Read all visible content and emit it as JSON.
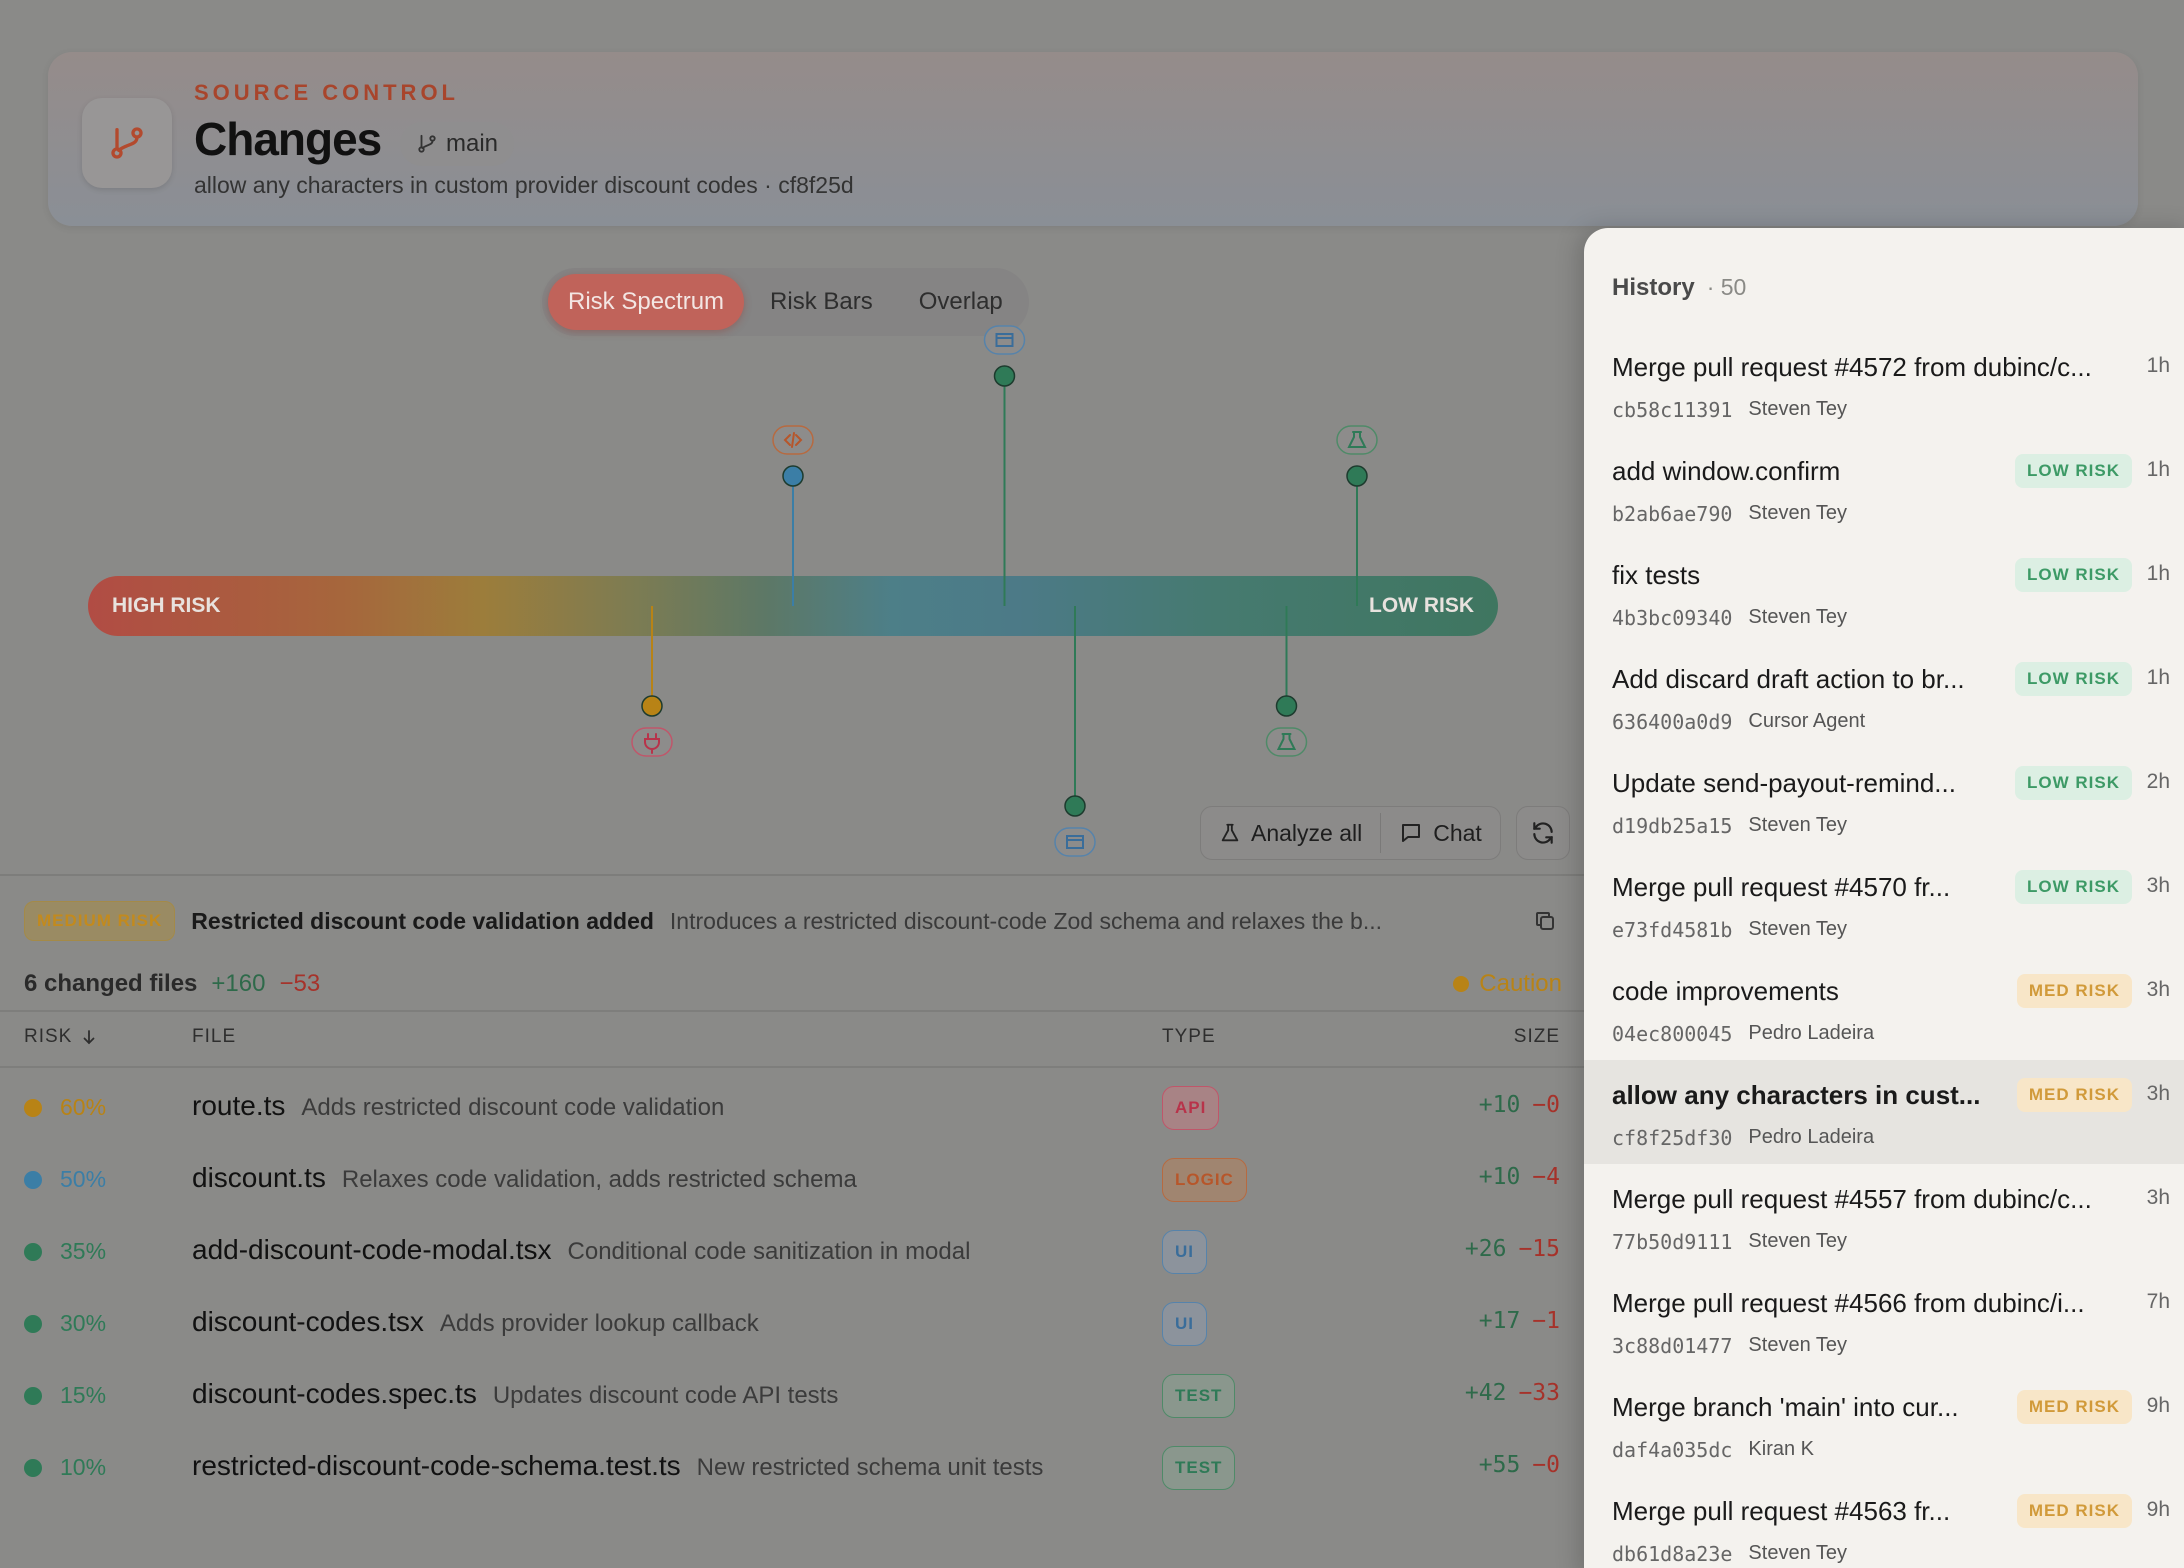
{
  "header": {
    "eyebrow": "SOURCE CONTROL",
    "title": "Changes",
    "branch": "main",
    "commit_line": "allow any characters in custom provider discount codes · cf8f25d"
  },
  "view_tabs": [
    {
      "label": "Risk Spectrum",
      "active": true
    },
    {
      "label": "Risk Bars",
      "active": false
    },
    {
      "label": "Overlap",
      "active": false
    }
  ],
  "spectrum": {
    "left_label": "HIGH RISK",
    "right_label": "LOW RISK",
    "markers": [
      {
        "risk": 60,
        "side": "below",
        "color": "#b88316",
        "icon": "plug-icon"
      },
      {
        "risk": 50,
        "side": "above",
        "color": "#3b7ea6",
        "icon": "code-icon"
      },
      {
        "risk": 35,
        "side": "above",
        "color": "#2f7a57",
        "icon": "window-icon"
      },
      {
        "risk": 30,
        "side": "below",
        "color": "#2f7a57",
        "icon": "window-icon"
      },
      {
        "risk": 15,
        "side": "below",
        "color": "#2f7a57",
        "icon": "flask-icon"
      },
      {
        "risk": 10,
        "side": "above",
        "color": "#2f7a57",
        "icon": "flask-icon"
      }
    ]
  },
  "actions": {
    "analyze_label": "Analyze all",
    "chat_label": "Chat"
  },
  "summary": {
    "badge": "MEDIUM RISK",
    "title": "Restricted discount code validation added",
    "description": "Introduces a restricted discount-code Zod schema and relaxes the b..."
  },
  "stats": {
    "label": "6 changed files",
    "additions": "+160",
    "deletions": "−53",
    "status": "Caution"
  },
  "table": {
    "headers": {
      "risk": "RISK",
      "file": "FILE",
      "type": "TYPE",
      "size": "SIZE"
    },
    "rows": [
      {
        "risk": "60%",
        "dot": "#b88316",
        "name": "route.ts",
        "desc": "Adds restricted discount code validation",
        "type": "API",
        "type_bg": "#a88385",
        "type_fg": "#b8334a",
        "type_border": "#c0566a",
        "add": "+10",
        "del": "−0"
      },
      {
        "risk": "50%",
        "dot": "#3b7ea6",
        "name": "discount.ts",
        "desc": "Relaxes code validation, adds restricted schema",
        "type": "LOGIC",
        "type_bg": "#a08570",
        "type_fg": "#b7562a",
        "type_border": "#b76a40",
        "add": "+10",
        "del": "−4"
      },
      {
        "risk": "35%",
        "dot": "#2f7a57",
        "name": "add-discount-code-modal.tsx",
        "desc": "Conditional code sanitization in modal",
        "type": "UI",
        "type_bg": "#8c939c",
        "type_fg": "#3a6d9a",
        "type_border": "#5683ab",
        "add": "+26",
        "del": "−15"
      },
      {
        "risk": "30%",
        "dot": "#2f7a57",
        "name": "discount-codes.tsx",
        "desc": "Adds provider lookup callback",
        "type": "UI",
        "type_bg": "#8c939c",
        "type_fg": "#3a6d9a",
        "type_border": "#5683ab",
        "add": "+17",
        "del": "−1"
      },
      {
        "risk": "15%",
        "dot": "#2f7a57",
        "name": "discount-codes.spec.ts",
        "desc": "Updates discount code API tests",
        "type": "TEST",
        "type_bg": "#8a978d",
        "type_fg": "#2f7a57",
        "type_border": "#4f8a68",
        "add": "+42",
        "del": "−33"
      },
      {
        "risk": "10%",
        "dot": "#2f7a57",
        "name": "restricted-discount-code-schema.test.ts",
        "desc": "New restricted schema unit tests",
        "type": "TEST",
        "type_bg": "#8a978d",
        "type_fg": "#2f7a57",
        "type_border": "#4f8a68",
        "add": "+55",
        "del": "−0"
      }
    ]
  },
  "history": {
    "title": "History",
    "count": "· 50",
    "items": [
      {
        "title": "Merge pull request #4572 from dubinc/c...",
        "hash": "cb58c11391",
        "author": "Steven Tey",
        "time": "1h",
        "badge": "",
        "level": ""
      },
      {
        "title": "add window.confirm",
        "hash": "b2ab6ae790",
        "author": "Steven Tey",
        "time": "1h",
        "badge": "LOW RISK",
        "level": "low"
      },
      {
        "title": "fix tests",
        "hash": "4b3bc09340",
        "author": "Steven Tey",
        "time": "1h",
        "badge": "LOW RISK",
        "level": "low"
      },
      {
        "title": "Add discard draft action to br...",
        "hash": "636400a0d9",
        "author": "Cursor Agent",
        "time": "1h",
        "badge": "LOW RISK",
        "level": "low"
      },
      {
        "title": "Update send-payout-remind...",
        "hash": "d19db25a15",
        "author": "Steven Tey",
        "time": "2h",
        "badge": "LOW RISK",
        "level": "low"
      },
      {
        "title": "Merge pull request #4570 fr...",
        "hash": "e73fd4581b",
        "author": "Steven Tey",
        "time": "3h",
        "badge": "LOW RISK",
        "level": "low"
      },
      {
        "title": "code improvements",
        "hash": "04ec800045",
        "author": "Pedro Ladeira",
        "time": "3h",
        "badge": "MED RISK",
        "level": "med"
      },
      {
        "title": "allow any characters in cust...",
        "hash": "cf8f25df30",
        "author": "Pedro Ladeira",
        "time": "3h",
        "badge": "MED RISK",
        "level": "med",
        "selected": true
      },
      {
        "title": "Merge pull request #4557 from dubinc/c...",
        "hash": "77b50d9111",
        "author": "Steven Tey",
        "time": "3h",
        "badge": "",
        "level": ""
      },
      {
        "title": "Merge pull request #4566 from dubinc/i...",
        "hash": "3c88d01477",
        "author": "Steven Tey",
        "time": "7h",
        "badge": "",
        "level": ""
      },
      {
        "title": "Merge branch 'main' into cur...",
        "hash": "daf4a035dc",
        "author": "Kiran K",
        "time": "9h",
        "badge": "MED RISK",
        "level": "med"
      },
      {
        "title": "Merge pull request #4563 fr...",
        "hash": "db61d8a23e",
        "author": "Steven Tey",
        "time": "9h",
        "badge": "MED RISK",
        "level": "med"
      }
    ]
  }
}
